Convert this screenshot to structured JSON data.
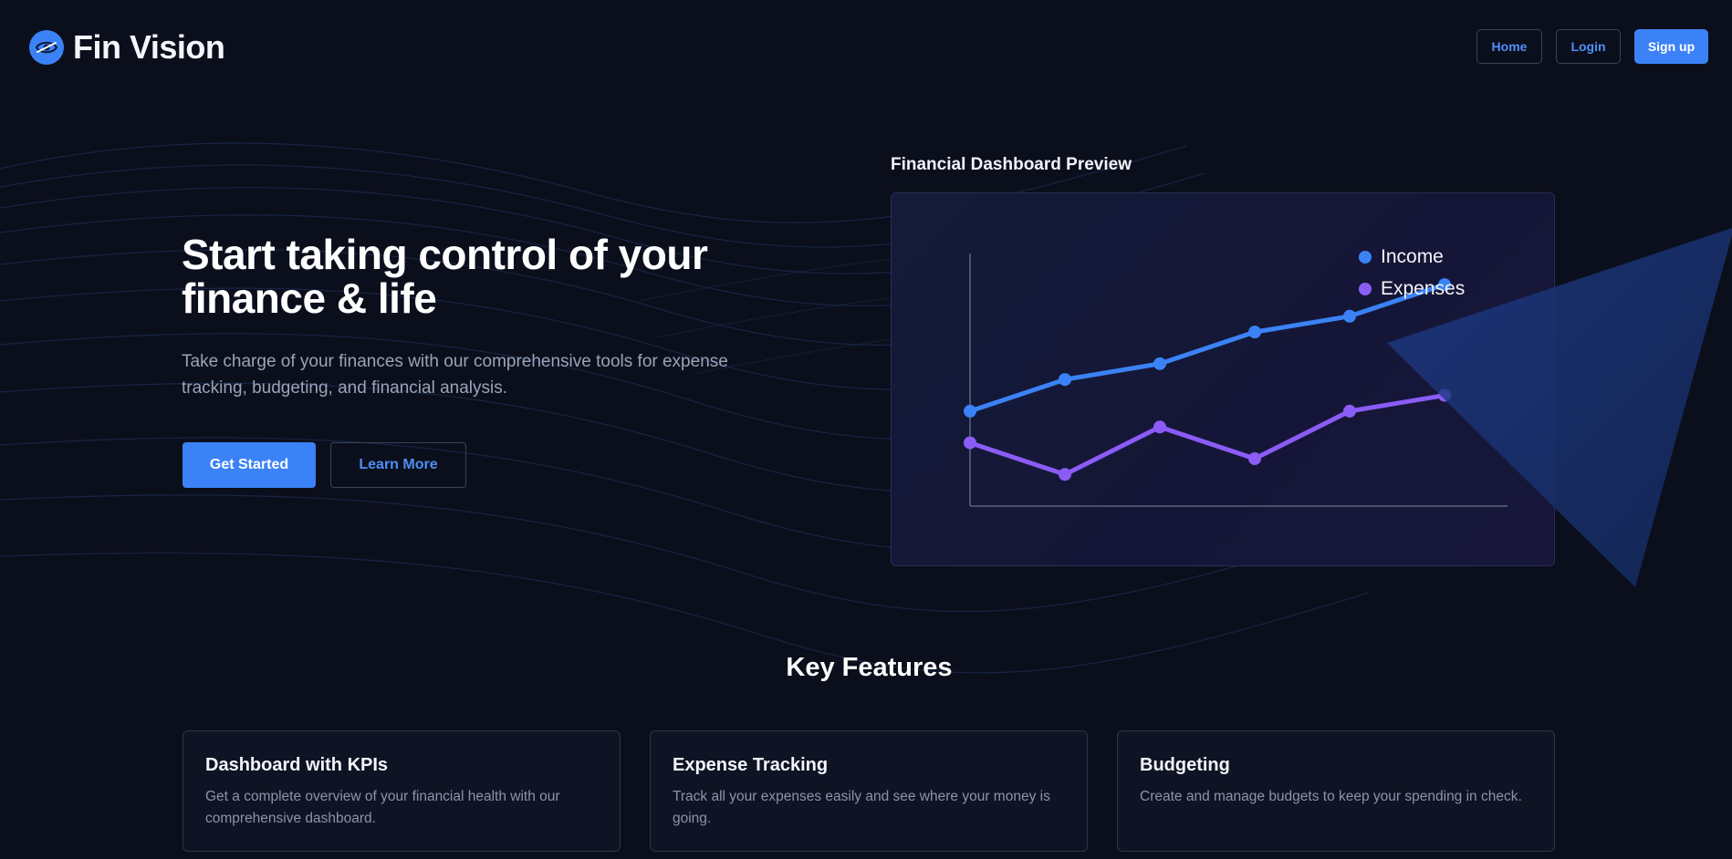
{
  "brand": {
    "name": "Fin Vision",
    "accent": "#3b82f6"
  },
  "nav": {
    "home": "Home",
    "login": "Login",
    "signup": "Sign up"
  },
  "hero": {
    "title": "Start taking control of your finance & life",
    "subtitle": "Take charge of your finances with our comprehensive tools for expense tracking, budgeting, and financial analysis.",
    "primary_button": "Get Started",
    "secondary_button": "Learn More"
  },
  "preview": {
    "title": "Financial Dashboard Preview"
  },
  "chart_data": {
    "type": "line",
    "x": [
      1,
      2,
      3,
      4,
      5,
      6
    ],
    "series": [
      {
        "name": "Income",
        "color": "#3b82f6",
        "values": [
          30,
          40,
          45,
          55,
          60,
          70
        ]
      },
      {
        "name": "Expenses",
        "color": "#8b5cf6",
        "values": [
          20,
          10,
          25,
          15,
          30,
          35
        ]
      }
    ],
    "legend_position": "top-right",
    "grid": false
  },
  "features": {
    "title": "Key Features",
    "items": [
      {
        "title": "Dashboard with KPIs",
        "description": "Get a complete overview of your financial health with our comprehensive dashboard."
      },
      {
        "title": "Expense Tracking",
        "description": "Track all your expenses easily and see where your money is going."
      },
      {
        "title": "Budgeting",
        "description": "Create and manage budgets to keep your spending in check."
      }
    ]
  }
}
